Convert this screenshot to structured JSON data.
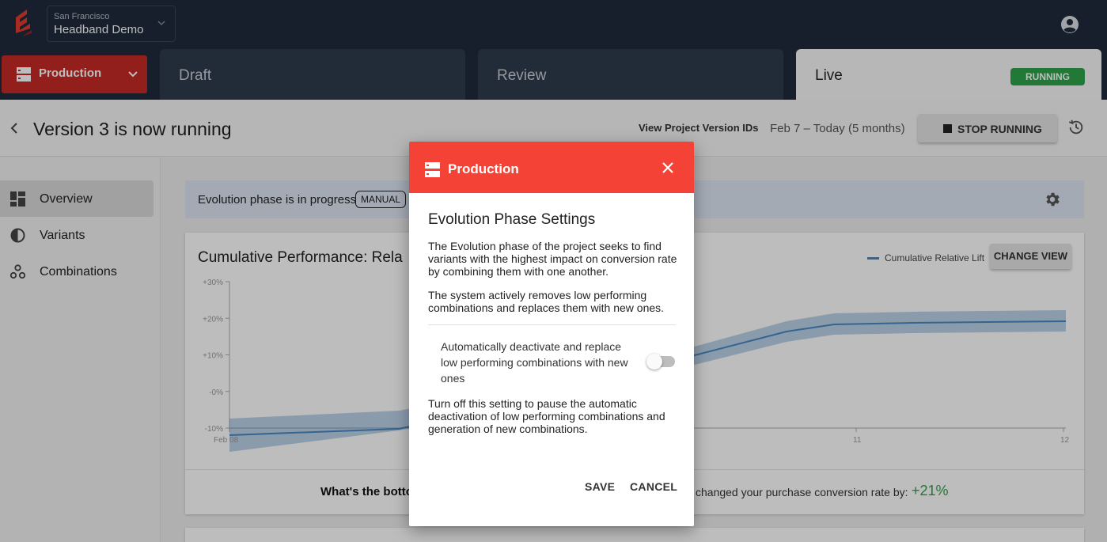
{
  "org": {
    "city": "San Francisco",
    "project": "Headband Demo"
  },
  "environment_button": {
    "label": "Production"
  },
  "tabs": [
    {
      "label": "Draft"
    },
    {
      "label": "Review"
    },
    {
      "label": "Live",
      "badge": "RUNNING"
    }
  ],
  "header": {
    "title": "Version 3 is now running",
    "view_ids_label": "View Project Version IDs",
    "date_range": "Feb 7 – Today (5 months)",
    "stop_label": "STOP RUNNING"
  },
  "sidebar": {
    "items": [
      {
        "label": "Overview",
        "icon": "dashboard-icon",
        "active": true
      },
      {
        "label": "Variants",
        "icon": "half-circle-icon"
      },
      {
        "label": "Combinations",
        "icon": "bubbles-icon"
      }
    ]
  },
  "banner": {
    "text": "Evolution phase is in progress",
    "badge": "MANUAL"
  },
  "performance": {
    "title": "Cumulative Performance: Rela",
    "legend": "Cumulative Relative Lift",
    "change_view": "CHANGE VIEW",
    "bottom_line_lead": "What's the botto",
    "bottom_line_rest": "changed your purchase conversion rate by:",
    "bottom_line_value": "+21%"
  },
  "chart_data": {
    "type": "area",
    "y_tick_labels": [
      "+30%",
      "+20%",
      "+10%",
      "-0%",
      "-10%"
    ],
    "x_tick_labels": [
      "Feb 08",
      "11",
      "12"
    ],
    "ylim": [
      -10,
      30
    ],
    "series": [
      {
        "name": "Cumulative Relative Lift"
      }
    ]
  },
  "dialog": {
    "header": "Production",
    "title": "Evolution Phase Settings",
    "para1": "The Evolution phase of the project seeks to find variants with the highest impact on conversion rate by combining them with one another.",
    "para2": "The system actively removes low performing combinations and replaces them with new ones.",
    "toggle_label": "Automatically deactivate and replace low performing combinations with new ones",
    "toggle_on": false,
    "para3": "Turn off this setting to pause the automatic deactivation of low performing combinations and generation of new combinations.",
    "save": "SAVE",
    "cancel": "CANCEL"
  },
  "colors": {
    "topbar": "#1e2a3b",
    "production_red": "#c62a25",
    "dialog_red": "#f44336",
    "running_green": "#2fa24a",
    "line_blue": "#4a87c4"
  }
}
